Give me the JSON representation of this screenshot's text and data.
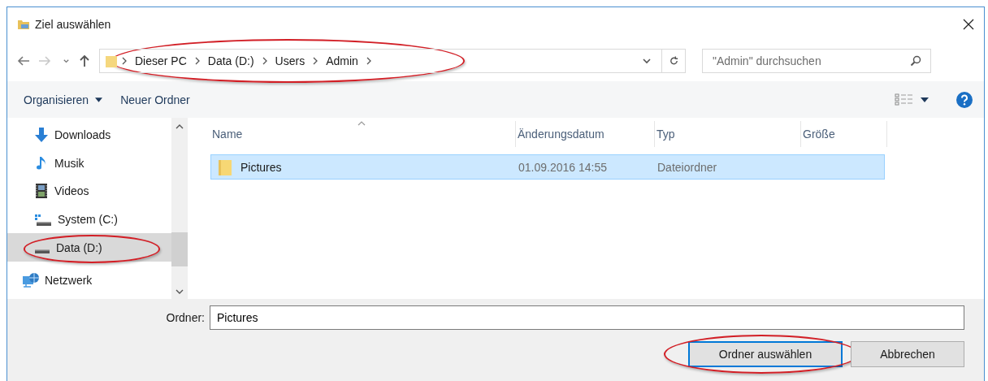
{
  "window": {
    "title": "Ziel auswählen"
  },
  "nav": {
    "back_enabled": true,
    "forward_enabled": false
  },
  "address": {
    "path": [
      "Dieser PC",
      "Data (D:)",
      "Users",
      "Admin"
    ],
    "circled": true
  },
  "search": {
    "placeholder": "\"Admin\" durchsuchen"
  },
  "toolbar": {
    "organize": "Organisieren",
    "new_folder": "Neuer Ordner"
  },
  "sidebar": {
    "items": [
      {
        "label": "Downloads",
        "kind": "downloads",
        "selected": false,
        "circled": false
      },
      {
        "label": "Musik",
        "kind": "music",
        "selected": false,
        "circled": false
      },
      {
        "label": "Videos",
        "kind": "videos",
        "selected": false,
        "circled": false
      },
      {
        "label": "System (C:)",
        "kind": "system",
        "selected": false,
        "circled": false
      },
      {
        "label": "Data (D:)",
        "kind": "drive",
        "selected": true,
        "circled": true
      },
      {
        "label": "Netzwerk",
        "kind": "network",
        "selected": false,
        "circled": false
      }
    ]
  },
  "table": {
    "columns": [
      "Name",
      "Änderungsdatum",
      "Typ",
      "Größe"
    ],
    "rows": [
      {
        "name": "Pictures",
        "date": "01.09.2016 14:55",
        "type": "Dateiordner",
        "selected": true
      }
    ]
  },
  "folder_field": {
    "label": "Ordner:",
    "value": "Pictures"
  },
  "buttons": [
    {
      "label": "Ordner auswählen",
      "default": true,
      "circled": true
    },
    {
      "label": "Abbrechen",
      "default": false,
      "circled": false
    }
  ]
}
